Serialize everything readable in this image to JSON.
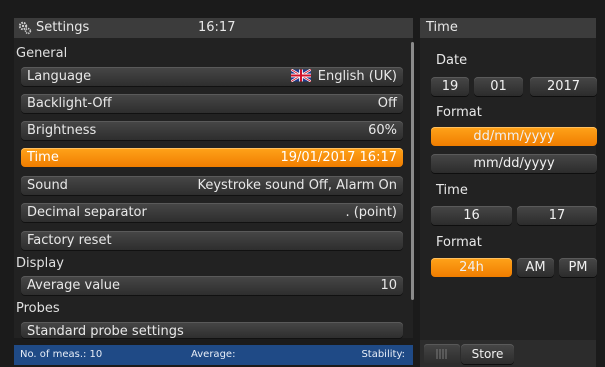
{
  "settings_header": {
    "title": "Settings",
    "time": "16:17"
  },
  "sections": {
    "general": "General",
    "display": "Display",
    "probes": "Probes"
  },
  "rows": {
    "language": {
      "label": "Language",
      "value": "English (UK)"
    },
    "backlight": {
      "label": "Backlight-Off",
      "value": "Off"
    },
    "brightness": {
      "label": "Brightness",
      "value": "60%"
    },
    "time": {
      "label": "Time",
      "value": "19/01/2017 16:17"
    },
    "sound": {
      "label": "Sound",
      "value": "Keystroke sound Off, Alarm On"
    },
    "decimal": {
      "label": "Decimal separator",
      "value": ". (point)"
    },
    "factory": {
      "label": "Factory reset"
    },
    "average": {
      "label": "Average value",
      "value": "10"
    },
    "probe_std": {
      "label": "Standard probe settings"
    }
  },
  "status_bar": {
    "meas": "No. of meas.: 10",
    "average": "Average:",
    "stability": "Stability:"
  },
  "time_panel": {
    "title": "Time",
    "date_label": "Date",
    "day": "19",
    "month": "01",
    "year": "2017",
    "format_label": "Format",
    "date_formats": [
      "dd/mm/yyyy",
      "mm/dd/yyyy"
    ],
    "time_label": "Time",
    "hour": "16",
    "minute": "17",
    "time_formats": [
      "24h",
      "AM",
      "PM"
    ]
  },
  "store_label": "Store",
  "colors": {
    "accent": "#f58a00",
    "status_bar": "#1f4a86"
  },
  "icons": {
    "header": "gear-icon",
    "language": "uk-flag-icon",
    "bottom": "menu-lines-icon"
  }
}
